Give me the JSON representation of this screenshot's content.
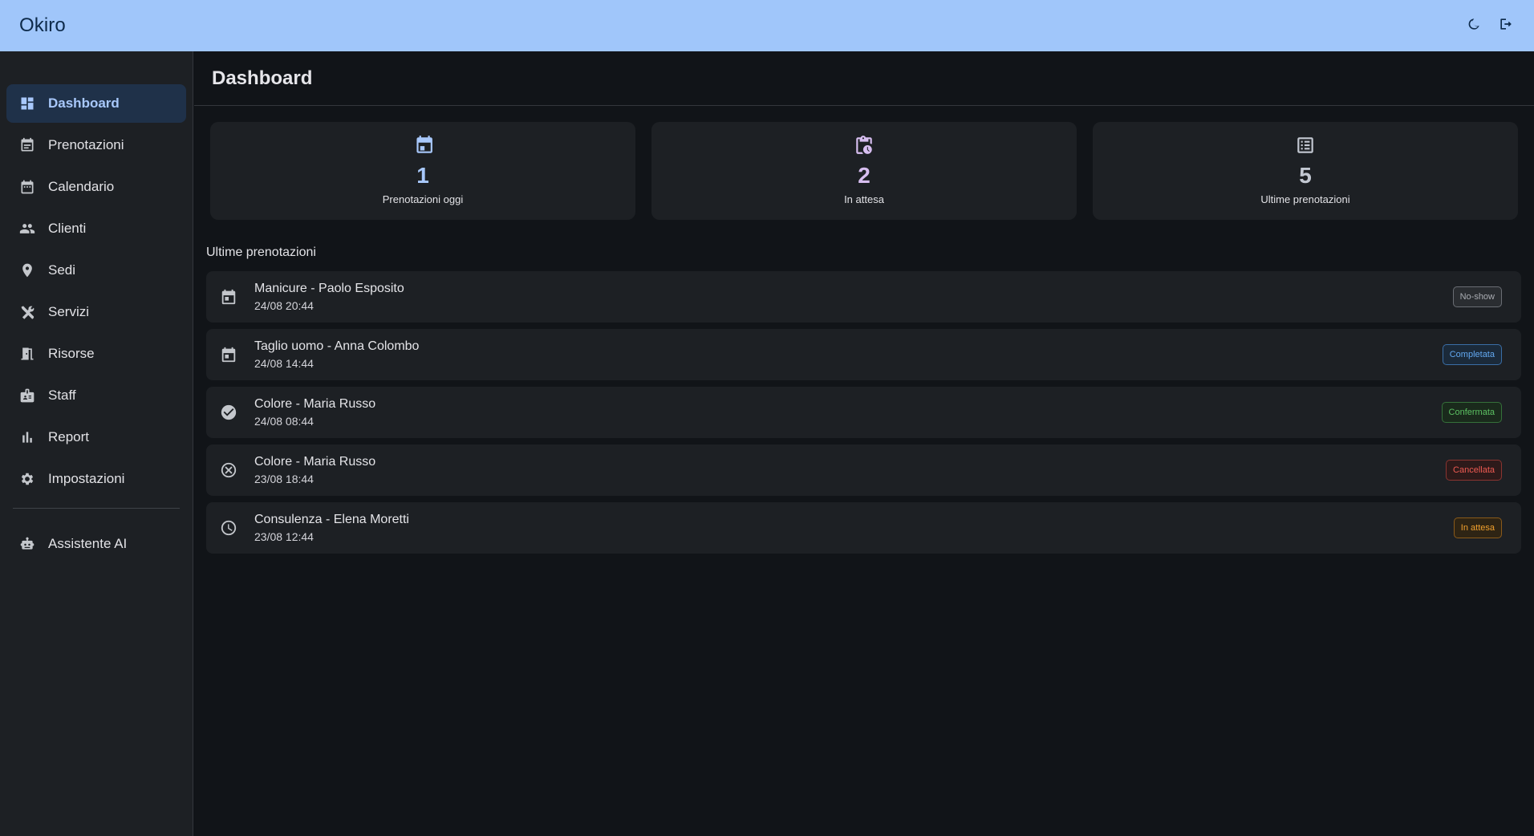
{
  "app": {
    "title": "Okiro"
  },
  "topbar": {
    "theme_icon": "moon-icon",
    "logout_icon": "logout-icon"
  },
  "sidebar": {
    "items": [
      {
        "label": "Dashboard",
        "icon": "dashboard-icon",
        "active": true
      },
      {
        "label": "Prenotazioni",
        "icon": "event-note-icon"
      },
      {
        "label": "Calendario",
        "icon": "calendar-icon"
      },
      {
        "label": "Clienti",
        "icon": "people-icon"
      },
      {
        "label": "Sedi",
        "icon": "location-pin-icon"
      },
      {
        "label": "Servizi",
        "icon": "tools-icon"
      },
      {
        "label": "Risorse",
        "icon": "door-icon"
      },
      {
        "label": "Staff",
        "icon": "badge-icon"
      },
      {
        "label": "Report",
        "icon": "bar-chart-icon"
      },
      {
        "label": "Impostazioni",
        "icon": "gear-icon"
      }
    ],
    "assistant": {
      "label": "Assistente AI",
      "icon": "robot-icon"
    }
  },
  "page": {
    "title": "Dashboard"
  },
  "stats": [
    {
      "value": "1",
      "label": "Prenotazioni oggi",
      "icon": "calendar-today-icon"
    },
    {
      "value": "2",
      "label": "In attesa",
      "icon": "clipboard-clock-icon"
    },
    {
      "value": "5",
      "label": "Ultime prenotazioni",
      "icon": "list-icon"
    }
  ],
  "recent": {
    "title": "Ultime prenotazioni",
    "rows": [
      {
        "title": "Manicure - Paolo Esposito",
        "datetime": "24/08 20:44",
        "status": "No-show",
        "icon": "calendar-icon"
      },
      {
        "title": "Taglio uomo - Anna Colombo",
        "datetime": "24/08 14:44",
        "status": "Completata",
        "icon": "calendar-icon"
      },
      {
        "title": "Colore - Maria Russo",
        "datetime": "24/08 08:44",
        "status": "Confermata",
        "icon": "check-circle-icon"
      },
      {
        "title": "Colore - Maria Russo",
        "datetime": "23/08 18:44",
        "status": "Cancellata",
        "icon": "cancel-circle-icon"
      },
      {
        "title": "Consulenza - Elena Moretti",
        "datetime": "23/08 12:44",
        "status": "In attesa",
        "icon": "clock-icon"
      }
    ]
  },
  "colors": {
    "topbar_bg": "#a0c6fa",
    "accent": "#a8c8fb",
    "status_noshow": "#a9acb2",
    "status_completed": "#62a8f0",
    "status_confirmed": "#5cc162",
    "status_cancelled": "#ee5a52",
    "status_pending": "#f2a12d"
  }
}
